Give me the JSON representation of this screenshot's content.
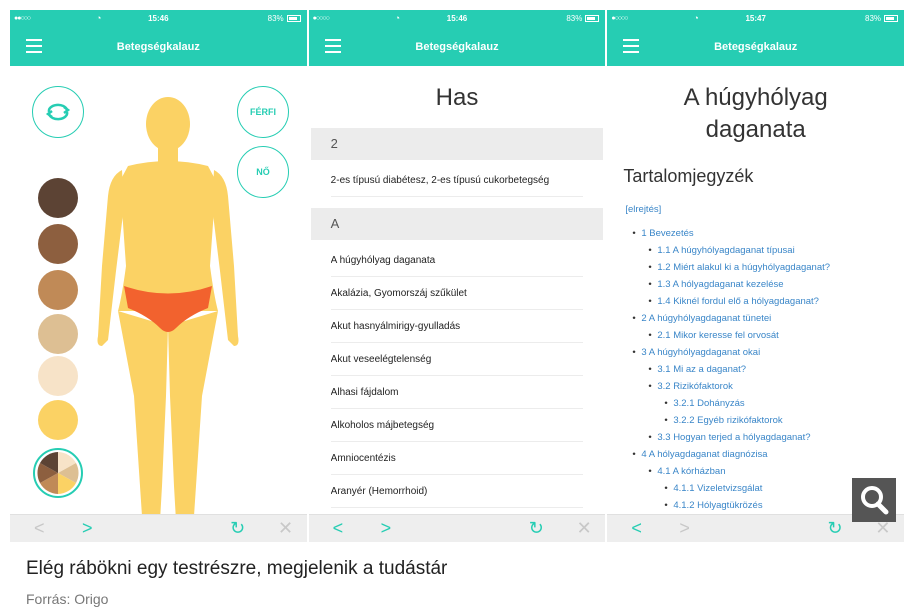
{
  "screens": [
    {
      "status": {
        "dots": "●●○○○",
        "time": "15:46",
        "battery": "83%"
      },
      "nav": {
        "title": "Betegségkalauz"
      },
      "male_label": "FÉRFI",
      "female_label": "NŐ",
      "skin_tones": [
        "#5c4334",
        "#8d5f3f",
        "#c08a57",
        "#ddbf93",
        "#f7e3c8",
        "#fbd264"
      ]
    },
    {
      "status": {
        "dots": "●○○○○",
        "time": "15:46",
        "battery": "83%"
      },
      "nav": {
        "title": "Betegségkalauz"
      },
      "heading": "Has",
      "sections": [
        {
          "letter": "2",
          "items": [
            "2-es típusú diabétesz, 2-es típusú cukorbetegség"
          ]
        },
        {
          "letter": "A",
          "items": [
            "A húgyhólyag daganata",
            "Akalázia, Gyomorszáj szűkület",
            "Akut hasnyálmirigy-gyulladás",
            "Akut veseelégtelenség",
            "Alhasi fájdalom",
            "Alkoholos májbetegség",
            "Amniocentézis",
            "Aranyér (Hemorrhoid)"
          ]
        }
      ]
    },
    {
      "status": {
        "dots": "●○○○○",
        "time": "15:47",
        "battery": "83%"
      },
      "nav": {
        "title": "Betegségkalauz"
      },
      "heading_line1": "A húgyhólyag",
      "heading_line2": "daganata",
      "toc_title": "Tartalomjegyzék",
      "toc_toggle": "[elrejtés]",
      "toc": [
        {
          "level": 1,
          "text": "1 Bevezetés"
        },
        {
          "level": 2,
          "text": "1.1 A húgyhólyagdaganat típusai"
        },
        {
          "level": 2,
          "text": "1.2 Miért alakul ki a húgyhólyagdaganat?"
        },
        {
          "level": 2,
          "text": "1.3 A hólyagdaganat kezelése"
        },
        {
          "level": 2,
          "text": "1.4 Kiknél fordul elő a hólyagdaganat?"
        },
        {
          "level": 1,
          "text": "2 A húgyhólyagdaganat tünetei"
        },
        {
          "level": 2,
          "text": "2.1 Mikor keresse fel orvosát"
        },
        {
          "level": 1,
          "text": "3 A húgyhólyagdaganat okai"
        },
        {
          "level": 2,
          "text": "3.1 Mi az a daganat?"
        },
        {
          "level": 2,
          "text": "3.2 Rizikófaktorok"
        },
        {
          "level": 3,
          "text": "3.2.1 Dohányzás"
        },
        {
          "level": 3,
          "text": "3.2.2 Egyéb rizikófaktorok"
        },
        {
          "level": 2,
          "text": "3.3 Hogyan terjed a hólyagdaganat?"
        },
        {
          "level": 1,
          "text": "4 A hólyagdaganat diagnózisa"
        },
        {
          "level": 2,
          "text": "4.1 A kórházban"
        },
        {
          "level": 3,
          "text": "4.1.1 Vizeletvizsgálat"
        },
        {
          "level": 3,
          "text": "4.1.2 Hólyagtükrözés"
        }
      ]
    }
  ],
  "caption": "Elég rábökni egy testrészre, megjelenik a tudástár",
  "source": "Forrás: Origo",
  "colors": {
    "accent": "#26cdb3",
    "body": "#fbd264",
    "underwear": "#f2622e"
  }
}
